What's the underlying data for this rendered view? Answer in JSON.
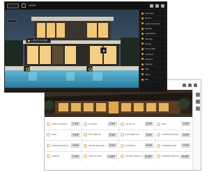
{
  "dark_app": {
    "top_bar": {
      "title": "HOME"
    },
    "scene_buttons": [
      {
        "label": "LIGHTS SCENE"
      }
    ],
    "menu": [
      {
        "label": "Favorites"
      },
      {
        "label": "Rooms"
      },
      {
        "label": "Lights & Scenes"
      },
      {
        "label": "Climate"
      },
      {
        "label": "Audio/Video"
      },
      {
        "label": "Security"
      },
      {
        "label": "Energy"
      },
      {
        "label": "Pool & Spa"
      },
      {
        "label": "Cameras"
      },
      {
        "label": "Intercom"
      },
      {
        "label": "Settings"
      },
      {
        "label": "Help"
      },
      {
        "label": "About"
      },
      {
        "label": "Exit"
      }
    ]
  },
  "light_app": {
    "buttons": [
      {
        "label": "ENTRY DRIVEWAY",
        "action": "STOP"
      },
      {
        "label": "IN HOUSE",
        "action": "STOP"
      },
      {
        "label": "LIGHTS ON",
        "action": "STOP"
      },
      {
        "label": "IDLE",
        "action": "STOP"
      },
      {
        "label": "SONY",
        "action": "STOP"
      },
      {
        "label": "SOUTHERN 40",
        "action": "STOP"
      },
      {
        "label": "SOUTHERN OFF",
        "action": "STOP"
      },
      {
        "label": "SPRINKLER ZONE 1",
        "action": "STOP"
      },
      {
        "label": "SPRINKLER ZONE 2",
        "action": "STOP"
      },
      {
        "label": "SPRINKLER ZONE 3",
        "action": "STOP"
      },
      {
        "label": "WATERFALL",
        "action": "STOP"
      },
      {
        "label": "WATERFEATURE",
        "action": "STOP"
      },
      {
        "label": "GARAGE",
        "action": "STOP"
      },
      {
        "label": "GARAGE DOOR",
        "action": "START"
      },
      {
        "label": "MASTER ZONES LANDSCAPE",
        "action": "START"
      },
      {
        "label": "MASTER ZONES POOL",
        "action": "START"
      }
    ]
  }
}
